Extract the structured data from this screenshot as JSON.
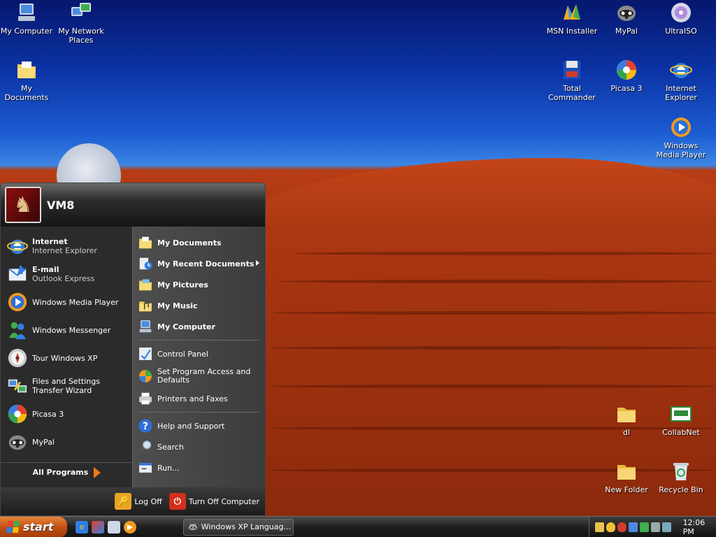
{
  "desktop": {
    "icons": [
      {
        "label": "My Computer",
        "icon": "my-computer-icon"
      },
      {
        "label": "My Network Places",
        "icon": "network-places-icon"
      },
      {
        "label": "My Documents",
        "icon": "my-documents-icon"
      },
      {
        "label": "MSN Installer",
        "icon": "msn-icon"
      },
      {
        "label": "MyPal",
        "icon": "mypal-icon"
      },
      {
        "label": "UltraISO",
        "icon": "ultraiso-icon"
      },
      {
        "label": "Total Commander",
        "icon": "total-commander-icon"
      },
      {
        "label": "Picasa 3",
        "icon": "picasa-icon"
      },
      {
        "label": "Internet Explorer",
        "icon": "internet-explorer-icon"
      },
      {
        "label": "Windows Media Player",
        "icon": "media-player-icon"
      },
      {
        "label": "dl",
        "icon": "folder-icon"
      },
      {
        "label": "CollabNet",
        "icon": "collabnet-icon"
      },
      {
        "label": "New Folder",
        "icon": "folder-icon"
      },
      {
        "label": "Recycle Bin",
        "icon": "recycle-bin-icon"
      }
    ]
  },
  "start_menu": {
    "user": "VM8",
    "left": [
      {
        "title": "Internet",
        "sub": "Internet Explorer",
        "icon": "internet-explorer-icon"
      },
      {
        "title": "E-mail",
        "sub": "Outlook Express",
        "icon": "outlook-express-icon"
      },
      {
        "title": "Windows Media Player",
        "icon": "media-player-icon"
      },
      {
        "title": "Windows Messenger",
        "icon": "messenger-icon"
      },
      {
        "title": "Tour Windows XP",
        "icon": "tour-icon"
      },
      {
        "title": "Files and Settings Transfer Wizard",
        "icon": "transfer-wizard-icon"
      },
      {
        "title": "Picasa 3",
        "icon": "picasa-icon"
      },
      {
        "title": "MyPal",
        "icon": "mypal-icon"
      }
    ],
    "all_programs": "All Programs",
    "right": [
      {
        "label": "My Documents",
        "icon": "my-documents-icon"
      },
      {
        "label": "My Recent Documents",
        "icon": "recent-documents-icon"
      },
      {
        "label": "My Pictures",
        "icon": "my-pictures-icon"
      },
      {
        "label": "My Music",
        "icon": "my-music-icon"
      },
      {
        "label": "My Computer",
        "icon": "my-computer-icon"
      },
      {
        "label": "Control Panel",
        "icon": "control-panel-icon"
      },
      {
        "label": "Set Program Access and Defaults",
        "icon": "program-access-icon"
      },
      {
        "label": "Printers and Faxes",
        "icon": "printer-icon"
      },
      {
        "label": "Help and Support",
        "icon": "help-icon"
      },
      {
        "label": "Search",
        "icon": "search-icon"
      },
      {
        "label": "Run...",
        "icon": "run-icon"
      }
    ],
    "log_off": "Log Off",
    "turn_off": "Turn Off Computer"
  },
  "taskbar": {
    "start": "start",
    "task": "Windows XP Languag...",
    "clock": "12:06 PM"
  }
}
